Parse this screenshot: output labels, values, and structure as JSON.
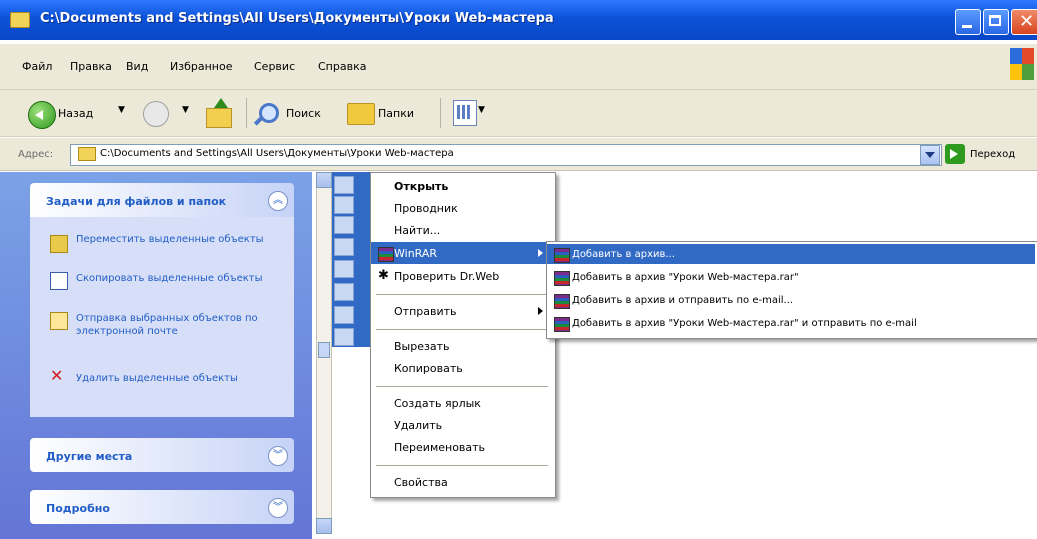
{
  "window": {
    "title": "C:\\Documents and Settings\\All Users\\Документы\\Уроки Web-мастера"
  },
  "menubar": {
    "items": [
      "Файл",
      "Правка",
      "Вид",
      "Избранное",
      "Сервис",
      "Справка"
    ]
  },
  "toolbar": {
    "back_label": "Назад",
    "search_label": "Поиск",
    "folders_label": "Папки"
  },
  "addressbar": {
    "label": "Адрес:",
    "value": "C:\\Documents and Settings\\All Users\\Документы\\Уроки Web-мастера",
    "go_label": "Переход"
  },
  "taskpane": {
    "file_tasks": {
      "title": "Задачи для файлов и папок",
      "items": [
        "Переместить выделенные объекты",
        "Скопировать выделенные объекты",
        "Отправка выбранных объектов по электронной почте",
        "Удалить выделенные объекты"
      ]
    },
    "other_places": {
      "title": "Другие места"
    },
    "details": {
      "title": "Подробно"
    }
  },
  "context_menu": {
    "items": [
      "Открыть",
      "Проводник",
      "Найти...",
      "WinRAR",
      "Проверить Dr.Web",
      "Отправить",
      "Вырезать",
      "Копировать",
      "Создать ярлык",
      "Удалить",
      "Переименовать",
      "Свойства"
    ]
  },
  "winrar_submenu": {
    "items": [
      "Добавить в архив...",
      "Добавить в архив \"Уроки Web-мастера.rar\"",
      "Добавить в архив и отправить по e-mail...",
      "Добавить в архив \"Уроки Web-мастера.rar\" и отправить по e-mail"
    ]
  },
  "colors": {
    "titlebar": "#0b52d8",
    "selection": "#316ac5",
    "taskpane_link": "#215dc6"
  }
}
